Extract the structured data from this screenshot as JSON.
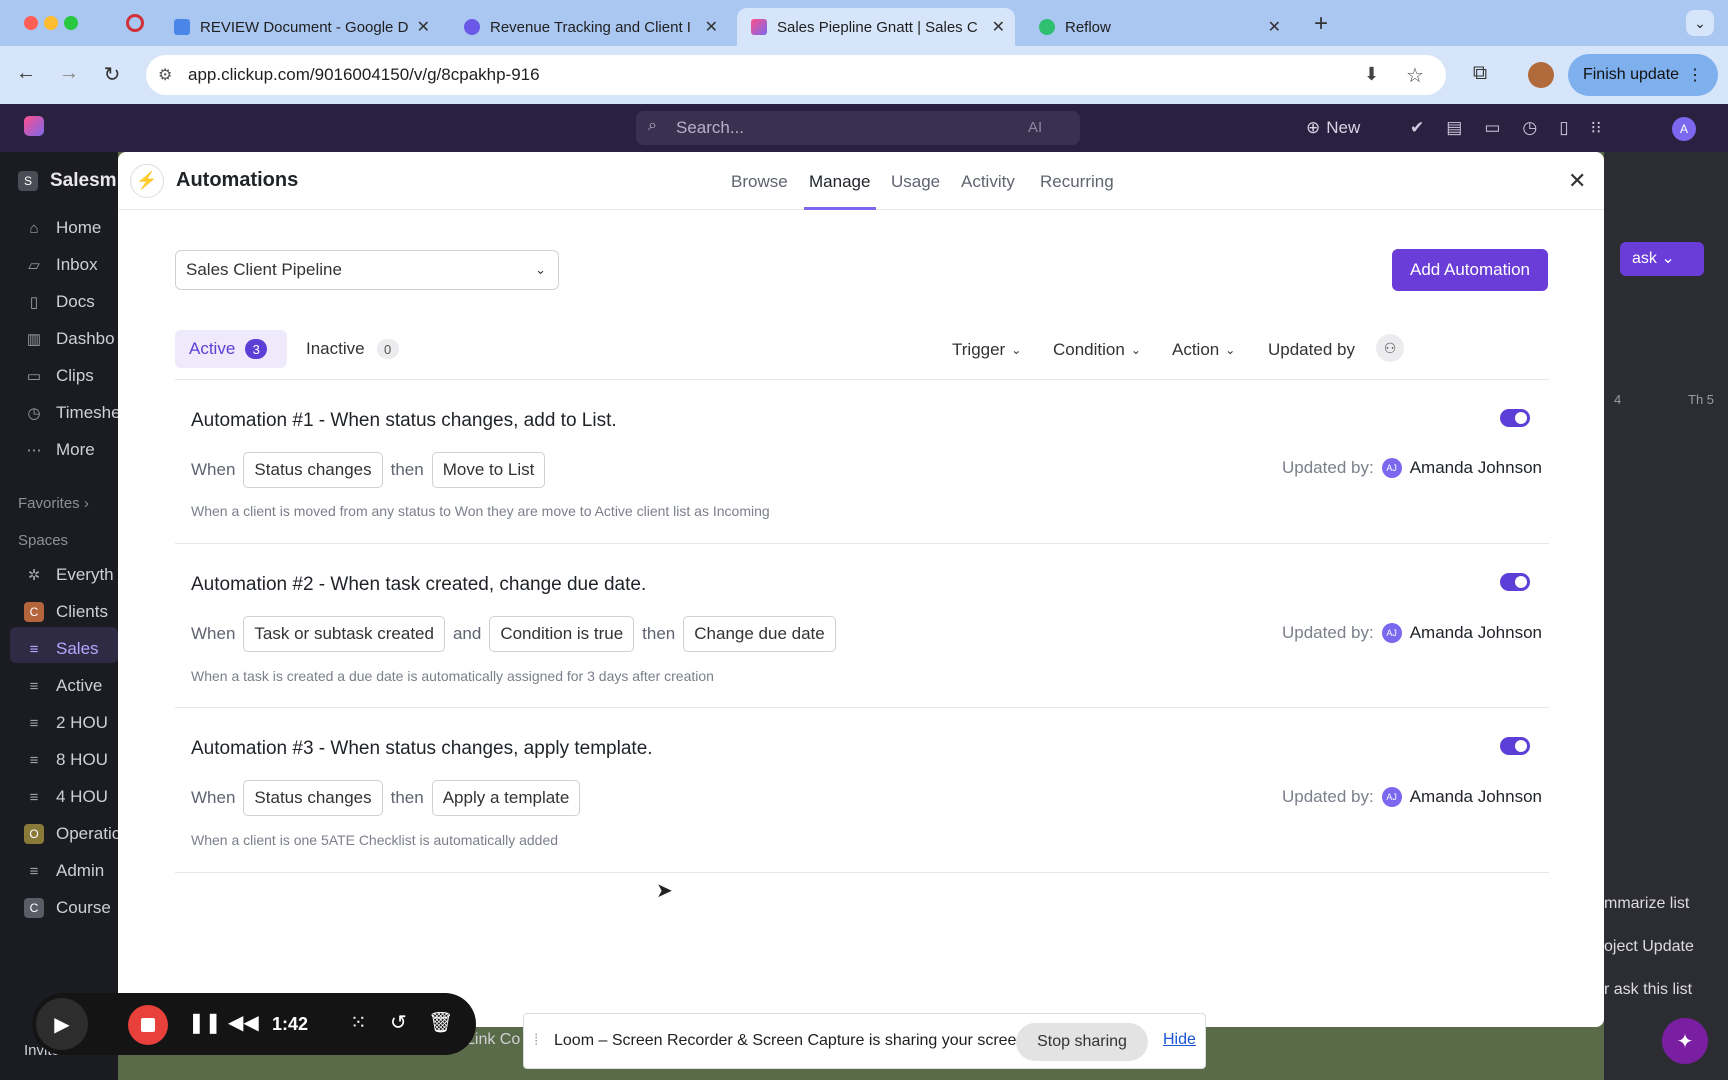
{
  "browser": {
    "tabs": [
      {
        "label": "REVIEW Document - Google D"
      },
      {
        "label": "Revenue Tracking and Client I"
      },
      {
        "label": "Sales Piepline Gnatt | Sales C"
      },
      {
        "label": "Reflow"
      }
    ],
    "url": "app.clickup.com/9016004150/v/g/8cpakhp-916",
    "finish_update": "Finish update"
  },
  "app": {
    "search_placeholder": "Search...",
    "ai_label": "AI",
    "new_label": "New",
    "workspace": "Salesm",
    "sidebar": [
      {
        "label": "Home"
      },
      {
        "label": "Inbox"
      },
      {
        "label": "Docs"
      },
      {
        "label": "Dashbo"
      },
      {
        "label": "Clips"
      },
      {
        "label": "Timeshe"
      },
      {
        "label": "More"
      }
    ],
    "favorites": "Favorites",
    "spaces": "Spaces",
    "space_items": [
      {
        "label": "Everyth"
      },
      {
        "label": "Clients",
        "letter": "C"
      },
      {
        "label": "Sales"
      },
      {
        "label": "Active"
      },
      {
        "label": "2 HOU"
      },
      {
        "label": "8 HOU"
      },
      {
        "label": "4 HOU"
      },
      {
        "label": "Operatio",
        "letter": "O"
      },
      {
        "label": "Admin"
      },
      {
        "label": "Course",
        "letter": "C"
      },
      {
        "label": "Invite"
      }
    ],
    "peek": {
      "task": "ask",
      "col1": "4",
      "col2": "Th 5",
      "summarize": "mmarize list",
      "project": "oject Update",
      "ask": "r ask this list",
      "link": "Link Co"
    }
  },
  "modal": {
    "title": "Automations",
    "tabs": [
      {
        "label": "Browse"
      },
      {
        "label": "Manage"
      },
      {
        "label": "Usage"
      },
      {
        "label": "Activity"
      },
      {
        "label": "Recurring"
      }
    ],
    "list_select": "Sales Client Pipeline",
    "add_button": "Add Automation",
    "active_label": "Active",
    "active_count": "3",
    "inactive_label": "Inactive",
    "inactive_count": "0",
    "filters": {
      "trigger": "Trigger",
      "condition": "Condition",
      "action": "Action",
      "updated_by": "Updated by"
    },
    "when": "When",
    "then": "then",
    "and": "and",
    "updated_by_label": "Updated by:",
    "automations": [
      {
        "title": "Automation #1 - When status changes, add to List.",
        "trigger": "Status changes",
        "action": "Move to List",
        "description": "When a client is moved from any status to Won they are move to Active client list as Incoming",
        "updated_by": "Amanda Johnson",
        "initials": "AJ"
      },
      {
        "title": "Automation #2 - When task created, change due date.",
        "trigger": "Task or subtask created",
        "condition": "Condition is true",
        "action": "Change due date",
        "description": "When a task is created a due date is automatically assigned for 3 days after creation",
        "updated_by": "Amanda Johnson",
        "initials": "AJ"
      },
      {
        "title": "Automation #3 - When status changes, apply template.",
        "trigger": "Status changes",
        "action": "Apply a template",
        "description": "When a client is one 5ATE Checklist is automatically added",
        "updated_by": "Amanda Johnson",
        "initials": "AJ"
      }
    ]
  },
  "recorder": {
    "time": "1:42"
  },
  "loom": {
    "message": "Loom – Screen Recorder & Screen Capture is sharing your screen.",
    "stop": "Stop sharing",
    "hide": "Hide"
  }
}
